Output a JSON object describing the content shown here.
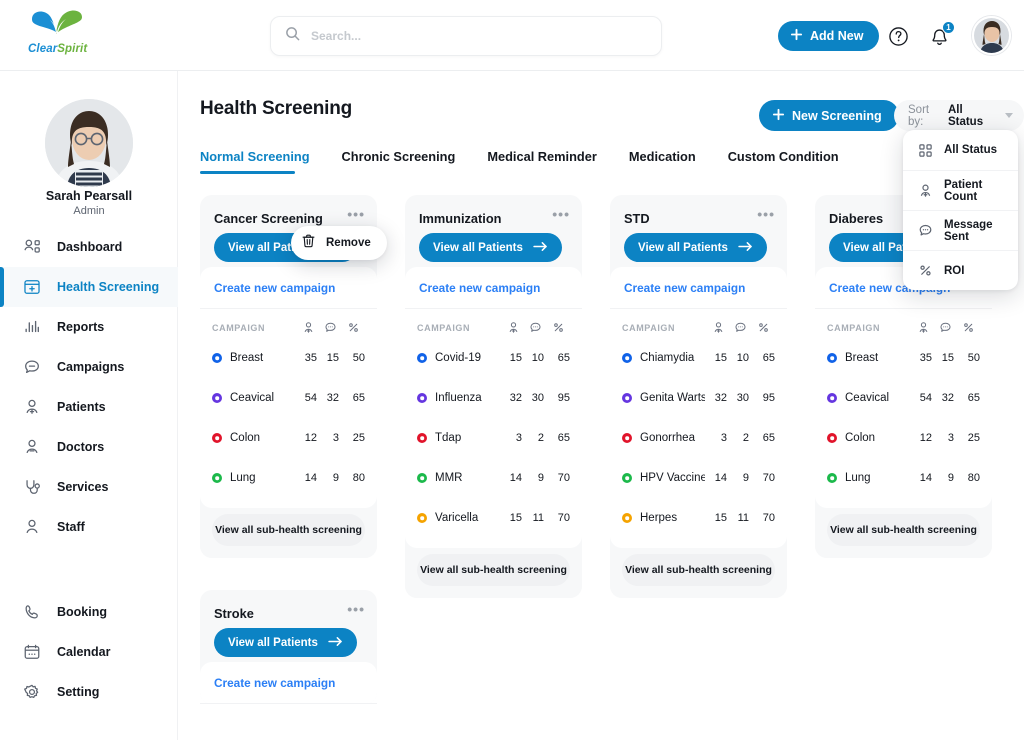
{
  "brand": {
    "name_part1": "Clear",
    "name_part2": "Spirit",
    "accent_blue": "#0c83c4",
    "accent_green": "#6cb33f"
  },
  "topbar": {
    "search_placeholder": "Search...",
    "search_value": "",
    "add_new_label": "Add New",
    "notification_count": "1"
  },
  "sidebar": {
    "user_name": "Sarah Pearsall",
    "user_role": "Admin",
    "items": [
      {
        "label": "Dashboard",
        "icon": "dashboard-icon",
        "active": false
      },
      {
        "label": "Health Screening",
        "icon": "health-screening-icon",
        "active": true
      },
      {
        "label": "Reports",
        "icon": "reports-icon",
        "active": false
      },
      {
        "label": "Campaigns",
        "icon": "campaigns-icon",
        "active": false
      },
      {
        "label": "Patients",
        "icon": "patients-icon",
        "active": false
      },
      {
        "label": "Doctors",
        "icon": "doctors-icon",
        "active": false
      },
      {
        "label": "Services",
        "icon": "services-icon",
        "active": false
      },
      {
        "label": "Staff",
        "icon": "staff-icon",
        "active": false
      }
    ],
    "bottom_items": [
      {
        "label": "Booking",
        "icon": "phone-icon"
      },
      {
        "label": "Calendar",
        "icon": "calendar-icon"
      },
      {
        "label": "Setting",
        "icon": "gear-icon"
      }
    ]
  },
  "main": {
    "page_title": "Health Screening",
    "new_screening_label": "New Screening",
    "sort_by_label": "Sort by:",
    "sort_by_value": "All Status",
    "tabs": [
      {
        "label": "Normal Screening",
        "active": true
      },
      {
        "label": "Chronic Screening",
        "active": false
      },
      {
        "label": "Medical Reminder",
        "active": false
      },
      {
        "label": "Medication",
        "active": false
      },
      {
        "label": "Custom Condition",
        "active": false
      }
    ]
  },
  "sort_dropdown": {
    "open": true,
    "items": [
      {
        "label": "All Status",
        "icon": "grid-icon"
      },
      {
        "label": "Patient Count",
        "icon": "person-add-icon"
      },
      {
        "label": "Message Sent",
        "icon": "chat-icon"
      },
      {
        "label": "ROI",
        "icon": "percent-icon"
      }
    ]
  },
  "card_context_menu": {
    "open": true,
    "label": "Remove",
    "icon": "trash-icon"
  },
  "labels": {
    "view_all_patients": "View all Patients",
    "create_new_campaign": "Create new campaign",
    "view_all_sub": "View all sub-health screening",
    "col_campaign": "CAMPAIGN"
  },
  "columns": [
    {
      "key": "patients",
      "icon": "person-add-icon"
    },
    {
      "key": "messages",
      "icon": "chat-icon"
    },
    {
      "key": "roi",
      "icon": "percent-icon"
    }
  ],
  "dot_colors": {
    "blue": "#1062e8",
    "purple": "#6536e0",
    "red": "#e1142b",
    "green": "#1cb94b",
    "orange": "#f5a300"
  },
  "cards": [
    {
      "title": "Cancer Screening",
      "rows": [
        {
          "name": "Breast",
          "color": "#1062e8",
          "patients": "35",
          "messages": "15",
          "roi": "50"
        },
        {
          "name": "Ceavical",
          "color": "#6536e0",
          "patients": "54",
          "messages": "32",
          "roi": "65"
        },
        {
          "name": "Colon",
          "color": "#e1142b",
          "patients": "12",
          "messages": "3",
          "roi": "25"
        },
        {
          "name": "Lung",
          "color": "#1cb94b",
          "patients": "14",
          "messages": "9",
          "roi": "80"
        }
      ]
    },
    {
      "title": "Immunization",
      "rows": [
        {
          "name": "Covid-19",
          "color": "#1062e8",
          "patients": "15",
          "messages": "10",
          "roi": "65"
        },
        {
          "name": "Influenza",
          "color": "#6536e0",
          "patients": "32",
          "messages": "30",
          "roi": "95"
        },
        {
          "name": "Tdap",
          "color": "#e1142b",
          "patients": "3",
          "messages": "2",
          "roi": "65"
        },
        {
          "name": "MMR",
          "color": "#1cb94b",
          "patients": "14",
          "messages": "9",
          "roi": "70"
        },
        {
          "name": "Varicella",
          "color": "#f5a300",
          "patients": "15",
          "messages": "11",
          "roi": "70"
        }
      ]
    },
    {
      "title": "STD",
      "rows": [
        {
          "name": "Chiamydia",
          "color": "#1062e8",
          "patients": "15",
          "messages": "10",
          "roi": "65"
        },
        {
          "name": "Genita Warts",
          "color": "#6536e0",
          "patients": "32",
          "messages": "30",
          "roi": "95"
        },
        {
          "name": "Gonorrhea",
          "color": "#e1142b",
          "patients": "3",
          "messages": "2",
          "roi": "65"
        },
        {
          "name": "HPV Vaccine",
          "color": "#1cb94b",
          "patients": "14",
          "messages": "9",
          "roi": "70"
        },
        {
          "name": "Herpes",
          "color": "#f5a300",
          "patients": "15",
          "messages": "11",
          "roi": "70"
        }
      ]
    },
    {
      "title": "Diaberes",
      "rows": [
        {
          "name": "Breast",
          "color": "#1062e8",
          "patients": "35",
          "messages": "15",
          "roi": "50"
        },
        {
          "name": "Ceavical",
          "color": "#6536e0",
          "patients": "54",
          "messages": "32",
          "roi": "65"
        },
        {
          "name": "Colon",
          "color": "#e1142b",
          "patients": "12",
          "messages": "3",
          "roi": "25"
        },
        {
          "name": "Lung",
          "color": "#1cb94b",
          "patients": "14",
          "messages": "9",
          "roi": "80"
        }
      ]
    },
    {
      "title": "Stroke",
      "rows": []
    }
  ]
}
